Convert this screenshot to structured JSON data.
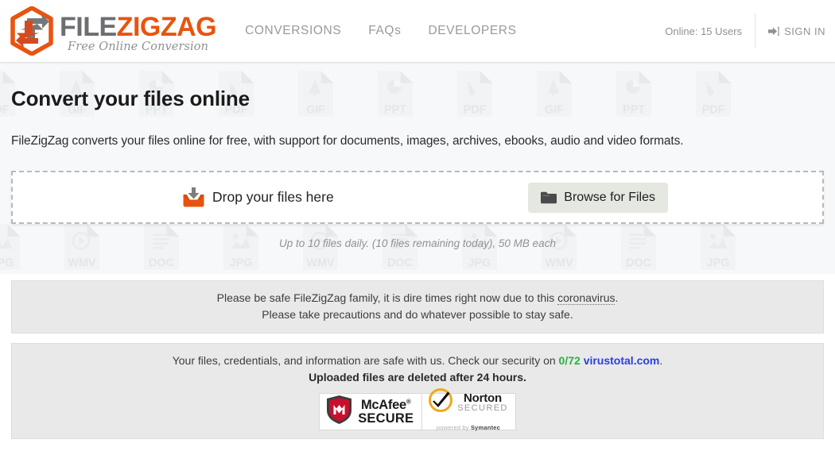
{
  "header": {
    "logo": {
      "icon": "filezigzag-hexagon-arrows-logo",
      "text_first": "FILE",
      "text_second": "ZIGZAG",
      "tagline": "Free Online Conversion"
    },
    "nav": [
      {
        "label": "CONVERSIONS",
        "name": "nav-conversions"
      },
      {
        "label": "FAQs",
        "name": "nav-faqs"
      },
      {
        "label": "DEVELOPERS",
        "name": "nav-developers"
      }
    ],
    "online_users": "Online: 15 Users",
    "signin_label": "SIGN IN",
    "signin_icon": "sign-in-arrow-icon"
  },
  "hero": {
    "title": "Convert your files online",
    "subtitle": "FileZigZag converts your files online for free, with support for documents, images, archives, ebooks, audio and video formats.",
    "dropzone": {
      "label": "Drop your files here",
      "icon": "download-tray-icon",
      "browse_label": "Browse for Files",
      "browse_icon": "folder-icon"
    },
    "limits": "Up to 10 files daily. (10 files remaining today), 50 MB each",
    "watermark_row_1": [
      "PDF",
      "GIF",
      "PPT",
      "PDF",
      "GIF",
      "PPT",
      "PDF",
      "GIF",
      "PPT",
      "PDF"
    ],
    "watermark_row_2": [
      "JPG",
      "WMV",
      "DOC",
      "JPG",
      "WMV",
      "DOC",
      "JPG",
      "WMV",
      "DOC",
      "JPG"
    ]
  },
  "notices": {
    "covid": {
      "line1_before": "Please be safe FileZigZag family, it is dire times right now due to this ",
      "link": "coronavirus",
      "line1_after": ".",
      "line2": "Please take precautions and do whatever possible to stay safe."
    },
    "security": {
      "line1_before": "Your files, credentials, and information are safe with us. Check our security on ",
      "score": "0/72",
      "link": "virustotal.com",
      "line1_after": ".",
      "line2": "Uploaded files are deleted after 24 hours."
    },
    "badges": [
      {
        "name": "mcafee-secure-badge",
        "icon": "mcafee-shield-icon",
        "top": "McAfee",
        "sup": "®",
        "bottom": "SECURE"
      },
      {
        "name": "norton-secured-badge",
        "icon": "norton-checkmark-icon",
        "top": "Norton",
        "bottom": "SECURED",
        "powered_prefix": "powered by ",
        "powered_brand": "Symantec"
      }
    ]
  },
  "colors": {
    "brand_orange": "#e8540f",
    "brand_gray": "#6d6e71",
    "hero_bg": "#f7f8fa",
    "notice_bg": "#e9e9e9",
    "score_green": "#27b33e",
    "link_blue": "#2b3fe0"
  }
}
